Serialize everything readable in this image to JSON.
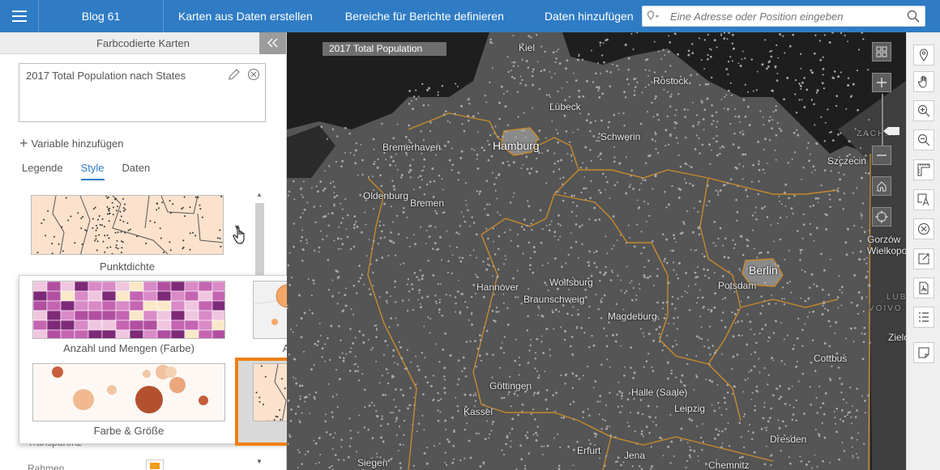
{
  "topbar": {
    "project_title": "Blog 61",
    "nav": [
      "Karten aus Daten erstellen",
      "Bereiche für Berichte definieren",
      "Daten hinzufügen"
    ],
    "search_placeholder": "Eine Adresse oder Position eingeben"
  },
  "panel": {
    "header": "Farbcodierte Karten",
    "title_text": "2017 Total Population nach States",
    "add_variable": "Variable hinzufügen",
    "tabs": [
      "Legende",
      "Style",
      "Daten"
    ],
    "active_tab": "Style",
    "current_style_label": "Punktdichte",
    "hidden_label_1": "Transparenz",
    "hidden_label_2": "Rahmen"
  },
  "style_options": [
    {
      "label": "Anzahl und Mengen (Farbe)"
    },
    {
      "label": "Anzahl und Mengen (Größe)"
    },
    {
      "label": "Farbe & Größe"
    },
    {
      "label": "Punktdichte"
    }
  ],
  "selected_style": "Punktdichte",
  "map": {
    "layer_title": "2017 Total Population",
    "cities": [
      "Kiel",
      "Rostock",
      "Lübeck",
      "Schwerin",
      "Hamburg",
      "Bremerhaven",
      "Szczecin",
      "Oldenburg",
      "Bremen",
      "Berlin",
      "Potsdam",
      "Hannover",
      "Wolfsburg",
      "Braunschweig",
      "Magdeburg",
      "Göttingen",
      "Halle (Saale)",
      "Leipzig",
      "Kassel",
      "Cottbus",
      "Dresden",
      "Erfurt",
      "Jena",
      "Siegen",
      "Chemnitz",
      "Gorzów Wielkopolski",
      "Zielona"
    ],
    "region_labels": [
      "ZACH...",
      "LUBU...",
      "VOIVO..."
    ]
  },
  "colors": {
    "topbar": "#2f7cc5",
    "highlight": "#f07e12",
    "map_land": "#5a5a5a",
    "map_border": "#c9892b"
  }
}
